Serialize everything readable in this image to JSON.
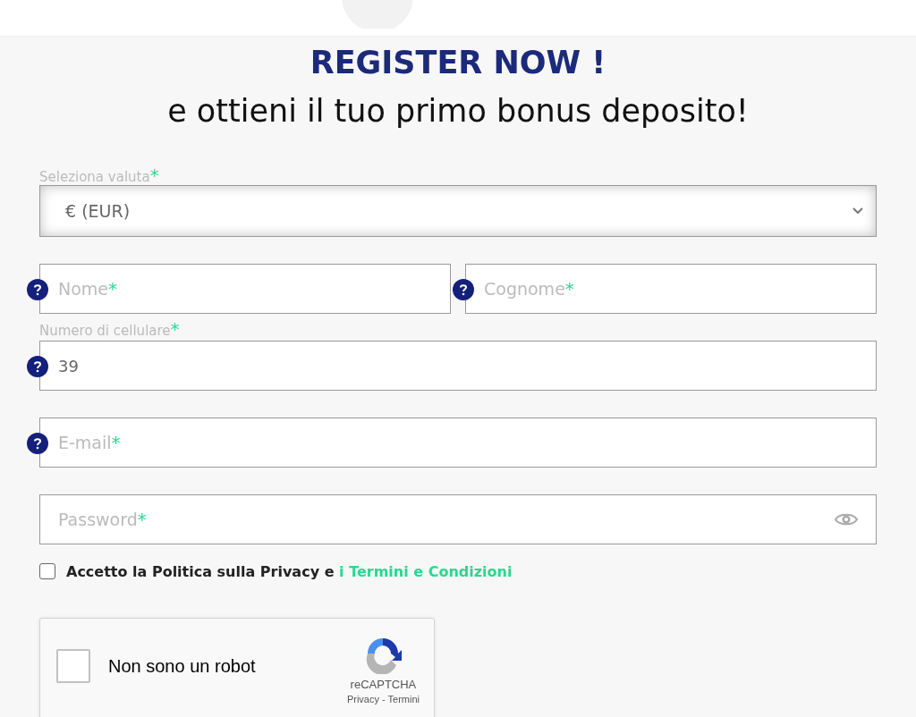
{
  "title": "REGISTER NOW !",
  "subtitle": "e ottieni il tuo primo bonus deposito!",
  "currency": {
    "label": "Seleziona valuta",
    "required_mark": "*",
    "value": "€ (EUR)"
  },
  "rows": [
    {
      "fields": [
        {
          "kind": "text",
          "placeholder": "Nome",
          "required_mark": "*",
          "help": true
        },
        {
          "kind": "text",
          "placeholder": "Cognome",
          "required_mark": "*",
          "help": true
        }
      ]
    },
    {
      "fields": [
        {
          "kind": "phone",
          "label": "Numero di cellulare",
          "required_mark": "*",
          "value": "39",
          "help": true
        }
      ]
    },
    {
      "fields": [
        {
          "kind": "email",
          "placeholder": "E-mail",
          "required_mark": "*",
          "help": true
        }
      ]
    },
    {
      "fields": [
        {
          "kind": "password",
          "placeholder": "Password",
          "required_mark": "*",
          "help": false
        }
      ]
    }
  ],
  "consent": {
    "checked": false,
    "text": "Accetto la Politica sulla Privacy e",
    "link": "i Termini e Condizioni"
  },
  "captcha": {
    "checked": false,
    "label": "Non sono un robot",
    "brand": "reCAPTCHA",
    "links": "Privacy - Termini"
  }
}
